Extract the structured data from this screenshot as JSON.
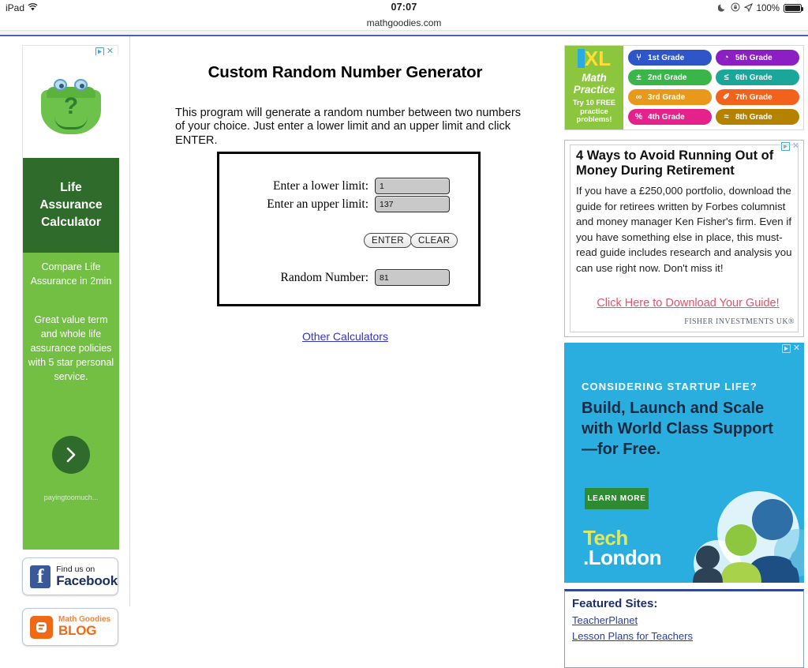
{
  "status_bar": {
    "device": "iPad",
    "wifi_icon": "wifi-icon",
    "time": "07:07",
    "do_not_disturb_icon": "moon-icon",
    "rotation_lock_icon": "rotation-lock-icon",
    "location_icon": "location-arrow-icon",
    "battery_percent": "100%",
    "battery_icon": "battery-full-icon"
  },
  "browser": {
    "url": "mathgoodies.com"
  },
  "center": {
    "title": "Custom Random Number Generator",
    "intro": "This program will generate a random number between two numbers of your choice. Just enter a lower limit and an upper limit and click ENTER.",
    "form": {
      "lower_label": "Enter a lower limit:",
      "lower_value": "1",
      "upper_label": "Enter an upper limit:",
      "upper_value": "137",
      "enter_button": "ENTER",
      "clear_button": "CLEAR",
      "result_label": "Random Number:",
      "result_value": "81"
    },
    "other_calculators_link": "Other Calculators"
  },
  "left_rail": {
    "ad": {
      "adchoices_icon": "adchoices-triangle-icon",
      "close_icon": "close-x-icon",
      "image_alt": "green-purse-question-mark",
      "band_line1": "Life",
      "band_line2": "Assurance",
      "band_line3": "Calculator",
      "headline": "Compare Life Assurance in 2min",
      "body": "Great value term and whole life assurance policies with 5 star personal service.",
      "cta_icon": "chevron-right-icon",
      "brand": "payingtoomuch..."
    },
    "facebook_badge": {
      "icon": "facebook-icon",
      "small": "Find us on",
      "big": "Facebook"
    },
    "blog_badge": {
      "icon": "blogger-icon",
      "small": "Math Goodies",
      "big": "BLOG"
    }
  },
  "right_rail": {
    "ixl_ad": {
      "logo": "IXL",
      "tagline_line1": "Math",
      "tagline_line2": "Practice",
      "free_line1": "Try 10 FREE",
      "free_line2": "practice",
      "free_line3": "problems!",
      "grades": [
        {
          "label": "1st Grade",
          "icon": "⑂",
          "color": "#2f56c9"
        },
        {
          "label": "5th Grade",
          "icon": "◔",
          "color": "#8b1fc4"
        },
        {
          "label": "2nd Grade",
          "icon": "±",
          "color": "#3ab549"
        },
        {
          "label": "6th Grade",
          "icon": "≤",
          "color": "#1aa79a"
        },
        {
          "label": "3rd Grade",
          "icon": "∞",
          "color": "#e8991b"
        },
        {
          "label": "7th Grade",
          "icon": "✐",
          "color": "#f3621c"
        },
        {
          "label": "4th Grade",
          "icon": "%",
          "color": "#e5228b"
        },
        {
          "label": "8th Grade",
          "icon": "≈",
          "color": "#b58200"
        }
      ]
    },
    "retirement_ad": {
      "adchoices_icon": "adchoices-triangle-icon",
      "close_icon": "close-x-icon",
      "headline": "4 Ways to Avoid Running Out of Money During Retirement",
      "body": "If you have a £250,000 portfolio, download the guide for retirees written by Forbes columnist and money manager Ken Fisher's firm. Even if you have something else in place, this must-read guide includes research and analysis you can use right now. Don't miss it!",
      "link": "Click Here to Download Your Guide!",
      "brand": "FISHER INVESTMENTS UK®"
    },
    "tech_ad": {
      "adchoices_icon": "adchoices-triangle-icon",
      "close_icon": "close-x-icon",
      "eyebrow": "CONSIDERING STARTUP LIFE?",
      "headline": "Build, Launch and Scale with World Class Support—for Free.",
      "button": "LEARN MORE",
      "logo_line1": "Tech",
      "logo_line2": ".London"
    },
    "featured": {
      "title": "Featured Sites:",
      "links": [
        "TeacherPlanet",
        "Lesson Plans for Teachers"
      ]
    }
  }
}
